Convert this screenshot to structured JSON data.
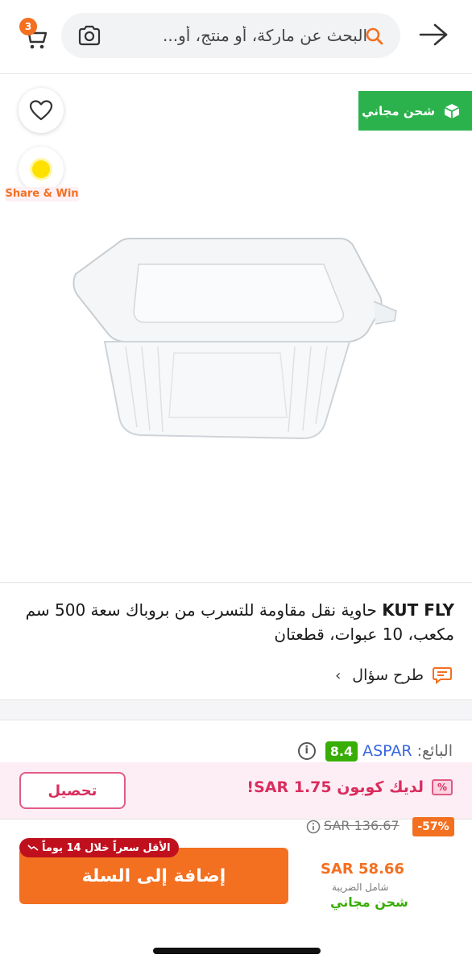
{
  "header": {
    "cart_count": "3",
    "search_placeholder": "البحث عن ماركة، أو منتج، أو..."
  },
  "image_area": {
    "free_shipping_badge": "شحن مجاني",
    "share_label": "Share & Win"
  },
  "product": {
    "brand": "KUT FLY",
    "title_rest": "حاوية نقل مقاومة للتسرب من بروباك سعة 500 سم مكعب، 10 عبوات، قطعتان",
    "ask_question": "طرح سؤال"
  },
  "seller": {
    "label": "البائع:",
    "name": "ASPAR",
    "rating": "8.4"
  },
  "coupon": {
    "text": "لديك كوبون SAR 1.75!",
    "collect_label": "تحصيل"
  },
  "pricing": {
    "discount": "-57%",
    "old_price": "SAR 136.67",
    "new_price": "SAR 58.66",
    "vat_note": "شامل الضريبة",
    "free_shipping": "شحن مجاني",
    "lowest_price_badge": "الأقل سعراً خلال 14 يوماً",
    "add_to_cart": "إضافة إلى السلة"
  },
  "colors": {
    "accent": "#f37021",
    "green": "#2bb24c",
    "seller_blue": "#3866df",
    "coupon_pink": "#d92d5e",
    "lowest_red": "#c0101e"
  }
}
